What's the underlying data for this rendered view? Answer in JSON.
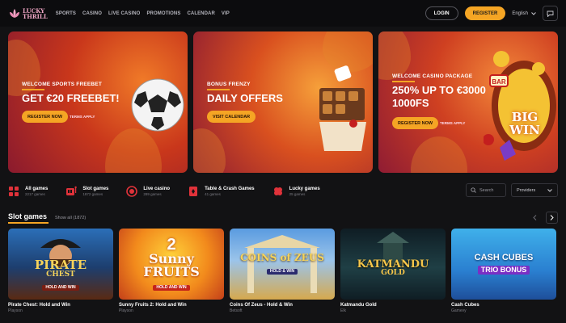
{
  "header": {
    "logo_text_1": "LUCKY",
    "logo_text_2": "THRILL",
    "nav": [
      "SPORTS",
      "CASINO",
      "LIVE CASINO",
      "PROMOTIONS",
      "CALENDAR",
      "VIP"
    ],
    "login_label": "LOGIN",
    "register_label": "REGISTER",
    "language": "English"
  },
  "banners": [
    {
      "eyebrow": "WELCOME SPORTS FREEBET",
      "title": "GET €20 FREEBET!",
      "button": "REGISTER NOW",
      "terms": "TERMS APPLY"
    },
    {
      "eyebrow": "BONUS FRENZY",
      "title": "DAILY OFFERS",
      "button": "VISIT CALENDAR"
    },
    {
      "eyebrow": "WELCOME CASINO PACKAGE",
      "title_line1": "250% UP TO €3000",
      "title_line2": "1000FS",
      "button": "REGISTER NOW",
      "terms": "TERMS APPLY",
      "badge_text": "BIG WIN"
    }
  ],
  "categories": [
    {
      "label": "All games",
      "count": "2217 games",
      "icon": "grid-icon"
    },
    {
      "label": "Slot games",
      "count": "1872 games",
      "icon": "slot-icon"
    },
    {
      "label": "Live casino",
      "count": "289 games",
      "icon": "live-icon"
    },
    {
      "label": "Table & Crash Games",
      "count": "41 games",
      "icon": "table-icon"
    },
    {
      "label": "Lucky games",
      "count": "25 games",
      "icon": "clover-icon"
    }
  ],
  "search": {
    "placeholder": "Search"
  },
  "providers_label": "Providers",
  "section": {
    "title": "Slot games",
    "show_all": "Show all (1872)"
  },
  "games": [
    {
      "title": "Pirate Chest: Hold and Win",
      "provider": "Playson",
      "art_line1": "PIRATE",
      "art_line2": "CHEST",
      "art_line3": "HOLD AND WIN"
    },
    {
      "title": "Sunny Fruits 2: Hold and Win",
      "provider": "Playson",
      "art_line1": "2",
      "art_line2": "Sunny",
      "art_line3": "FRUITS",
      "art_line4": "HOLD AND WIN"
    },
    {
      "title": "Coins Of Zeus - Hold & Win",
      "provider": "Betsoft",
      "art_line1": "COINS of ZEUS",
      "art_line2": "HOLD & WIN"
    },
    {
      "title": "Katmandu Gold",
      "provider": "Elk",
      "art_line1": "KATMANDU",
      "art_line2": "GOLD"
    },
    {
      "title": "Cash Cubes",
      "provider": "Gamevy",
      "art_line1": "CASH CUBES",
      "art_line2": "TRIO BONUS"
    }
  ],
  "colors": {
    "accent": "#f5a524",
    "background": "#121214"
  }
}
